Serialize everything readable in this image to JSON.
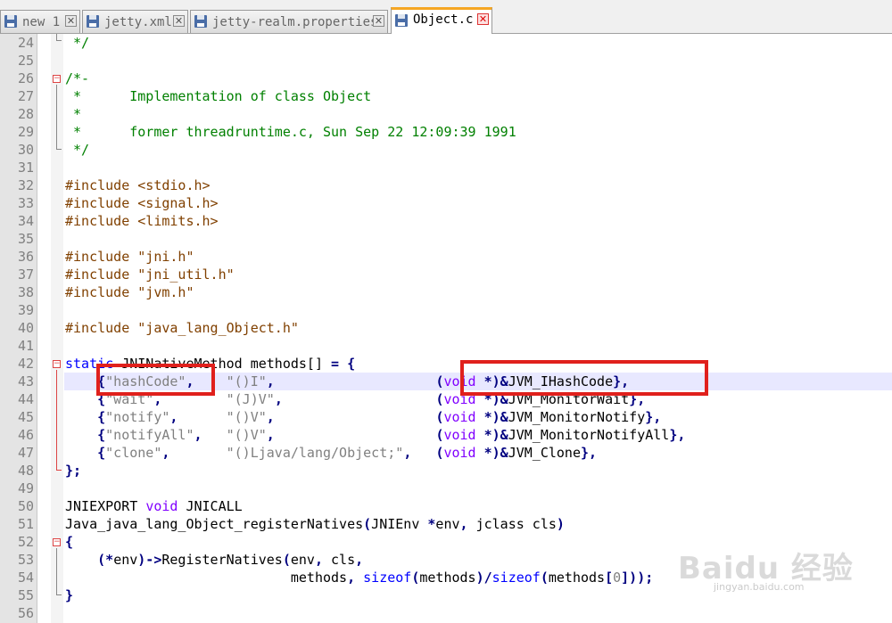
{
  "tabs": [
    {
      "label": "new 1",
      "active": false
    },
    {
      "label": "jetty.xml",
      "active": false
    },
    {
      "label": "jetty-realm.properties",
      "active": false
    },
    {
      "label": "Object.c",
      "active": true
    }
  ],
  "lines": [
    {
      "n": "24",
      "segs": [
        [
          "cm",
          " */"
        ]
      ]
    },
    {
      "n": "25",
      "segs": []
    },
    {
      "n": "26",
      "segs": [
        [
          "cm",
          "/*-"
        ]
      ]
    },
    {
      "n": "27",
      "segs": [
        [
          "cm",
          " *      Implementation of class Object"
        ]
      ]
    },
    {
      "n": "28",
      "segs": [
        [
          "cm",
          " *"
        ]
      ]
    },
    {
      "n": "29",
      "segs": [
        [
          "cm",
          " *      former threadruntime.c, Sun Sep 22 12:09:39 1991"
        ]
      ]
    },
    {
      "n": "30",
      "segs": [
        [
          "cm",
          " */"
        ]
      ]
    },
    {
      "n": "31",
      "segs": []
    },
    {
      "n": "32",
      "segs": [
        [
          "pp",
          "#include <stdio.h>"
        ]
      ]
    },
    {
      "n": "33",
      "segs": [
        [
          "pp",
          "#include <signal.h>"
        ]
      ]
    },
    {
      "n": "34",
      "segs": [
        [
          "pp",
          "#include <limits.h>"
        ]
      ]
    },
    {
      "n": "35",
      "segs": []
    },
    {
      "n": "36",
      "segs": [
        [
          "pp",
          "#include \"jni.h\""
        ]
      ]
    },
    {
      "n": "37",
      "segs": [
        [
          "pp",
          "#include \"jni_util.h\""
        ]
      ]
    },
    {
      "n": "38",
      "segs": [
        [
          "pp",
          "#include \"jvm.h\""
        ]
      ]
    },
    {
      "n": "39",
      "segs": []
    },
    {
      "n": "40",
      "segs": [
        [
          "pp",
          "#include \"java_lang_Object.h\""
        ]
      ]
    },
    {
      "n": "41",
      "segs": []
    },
    {
      "n": "42",
      "segs": [
        [
          "kw",
          "static"
        ],
        [
          "id",
          " JNINativeMethod methods[] "
        ],
        [
          "op",
          "="
        ],
        [
          "id",
          " "
        ],
        [
          "op",
          "{"
        ]
      ]
    },
    {
      "n": "43",
      "segs": [
        [
          "id",
          "    "
        ],
        [
          "op",
          "{"
        ],
        [
          "st",
          "\"hashCode\""
        ],
        [
          "op",
          ","
        ],
        [
          "id",
          "    "
        ],
        [
          "st",
          "\"()I\""
        ],
        [
          "op",
          ","
        ],
        [
          "id",
          "                    "
        ],
        [
          "op",
          "("
        ],
        [
          "ty",
          "void"
        ],
        [
          "id",
          " "
        ],
        [
          "op",
          "*)&"
        ],
        [
          "id",
          "JVM_IHashCode"
        ],
        [
          "op",
          "},"
        ]
      ]
    },
    {
      "n": "44",
      "segs": [
        [
          "id",
          "    "
        ],
        [
          "op",
          "{"
        ],
        [
          "st",
          "\"wait\""
        ],
        [
          "op",
          ","
        ],
        [
          "id",
          "        "
        ],
        [
          "st",
          "\"(J)V\""
        ],
        [
          "op",
          ","
        ],
        [
          "id",
          "                   "
        ],
        [
          "op",
          "("
        ],
        [
          "ty",
          "void"
        ],
        [
          "id",
          " "
        ],
        [
          "op",
          "*)&"
        ],
        [
          "id",
          "JVM_MonitorWait"
        ],
        [
          "op",
          "},"
        ]
      ]
    },
    {
      "n": "45",
      "segs": [
        [
          "id",
          "    "
        ],
        [
          "op",
          "{"
        ],
        [
          "st",
          "\"notify\""
        ],
        [
          "op",
          ","
        ],
        [
          "id",
          "      "
        ],
        [
          "st",
          "\"()V\""
        ],
        [
          "op",
          ","
        ],
        [
          "id",
          "                    "
        ],
        [
          "op",
          "("
        ],
        [
          "ty",
          "void"
        ],
        [
          "id",
          " "
        ],
        [
          "op",
          "*)&"
        ],
        [
          "id",
          "JVM_MonitorNotify"
        ],
        [
          "op",
          "},"
        ]
      ]
    },
    {
      "n": "46",
      "segs": [
        [
          "id",
          "    "
        ],
        [
          "op",
          "{"
        ],
        [
          "st",
          "\"notifyAll\""
        ],
        [
          "op",
          ","
        ],
        [
          "id",
          "   "
        ],
        [
          "st",
          "\"()V\""
        ],
        [
          "op",
          ","
        ],
        [
          "id",
          "                    "
        ],
        [
          "op",
          "("
        ],
        [
          "ty",
          "void"
        ],
        [
          "id",
          " "
        ],
        [
          "op",
          "*)&"
        ],
        [
          "id",
          "JVM_MonitorNotifyAll"
        ],
        [
          "op",
          "},"
        ]
      ]
    },
    {
      "n": "47",
      "segs": [
        [
          "id",
          "    "
        ],
        [
          "op",
          "{"
        ],
        [
          "st",
          "\"clone\""
        ],
        [
          "op",
          ","
        ],
        [
          "id",
          "       "
        ],
        [
          "st",
          "\"()Ljava/lang/Object;\""
        ],
        [
          "op",
          ","
        ],
        [
          "id",
          "   "
        ],
        [
          "op",
          "("
        ],
        [
          "ty",
          "void"
        ],
        [
          "id",
          " "
        ],
        [
          "op",
          "*)&"
        ],
        [
          "id",
          "JVM_Clone"
        ],
        [
          "op",
          "},"
        ]
      ]
    },
    {
      "n": "48",
      "segs": [
        [
          "op",
          "};"
        ]
      ]
    },
    {
      "n": "49",
      "segs": []
    },
    {
      "n": "50",
      "segs": [
        [
          "id",
          "JNIEXPORT "
        ],
        [
          "ty",
          "void"
        ],
        [
          "id",
          " JNICALL"
        ]
      ]
    },
    {
      "n": "51",
      "segs": [
        [
          "id",
          "Java_java_lang_Object_registerNatives"
        ],
        [
          "op",
          "("
        ],
        [
          "id",
          "JNIEnv "
        ],
        [
          "op",
          "*"
        ],
        [
          "id",
          "env"
        ],
        [
          "op",
          ","
        ],
        [
          "id",
          " jclass cls"
        ],
        [
          "op",
          ")"
        ]
      ]
    },
    {
      "n": "52",
      "segs": [
        [
          "op",
          "{"
        ]
      ]
    },
    {
      "n": "53",
      "segs": [
        [
          "id",
          "    "
        ],
        [
          "op",
          "(*"
        ],
        [
          "id",
          "env"
        ],
        [
          "op",
          ")->"
        ],
        [
          "id",
          "RegisterNatives"
        ],
        [
          "op",
          "("
        ],
        [
          "id",
          "env"
        ],
        [
          "op",
          ","
        ],
        [
          "id",
          " cls"
        ],
        [
          "op",
          ","
        ]
      ]
    },
    {
      "n": "54",
      "segs": [
        [
          "id",
          "                            methods"
        ],
        [
          "op",
          ","
        ],
        [
          "id",
          " "
        ],
        [
          "kw",
          "sizeof"
        ],
        [
          "op",
          "("
        ],
        [
          "id",
          "methods"
        ],
        [
          "op",
          ")/"
        ],
        [
          "kw",
          "sizeof"
        ],
        [
          "op",
          "("
        ],
        [
          "id",
          "methods"
        ],
        [
          "op",
          "["
        ],
        [
          "st",
          "0"
        ],
        [
          "op",
          "]));"
        ]
      ]
    },
    {
      "n": "55",
      "segs": [
        [
          "op",
          "}"
        ]
      ]
    },
    {
      "n": "56",
      "segs": []
    }
  ],
  "watermark": {
    "text": "Baidu 经验",
    "sub": "jingyan.baidu.com"
  }
}
